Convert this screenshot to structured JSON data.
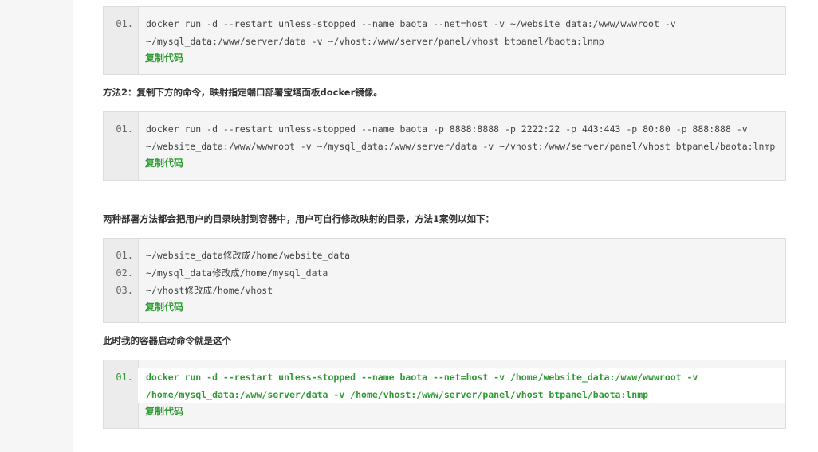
{
  "blocks": [
    {
      "lines": [
        {
          "num": "01.",
          "text": "docker run -d --restart unless-stopped --name baota --net=host -v ~/website_data:/www/wwwroot -v"
        },
        {
          "num": "",
          "text": "~/mysql_data:/www/server/data -v ~/vhost:/www/server/panel/vhost btpanel/baota:lnmp"
        }
      ],
      "copy_label": "复制代码"
    },
    {
      "lines": [
        {
          "num": "01.",
          "text": "docker run -d --restart unless-stopped --name baota -p 8888:8888 -p 2222:22 -p 443:443 -p 80:80 -p 888:888 -v"
        },
        {
          "num": "",
          "text": "~/website_data:/www/wwwroot -v ~/mysql_data:/www/server/data -v ~/vhost:/www/server/panel/vhost btpanel/baota:lnmp"
        }
      ],
      "copy_label": "复制代码"
    },
    {
      "lines": [
        {
          "num": "01.",
          "text": "~/website_data修改成/home/website_data"
        },
        {
          "num": "02.",
          "text": "~/mysql_data修改成/home/mysql_data"
        },
        {
          "num": "03.",
          "text": "~/vhost修改成/home/vhost"
        }
      ],
      "copy_label": "复制代码"
    },
    {
      "lines": [
        {
          "num": "01.",
          "text": "docker run -d --restart unless-stopped --name baota --net=host -v /home/website_data:/www/wwwroot -v"
        },
        {
          "num": "",
          "text": "/home/mysql_data:/www/server/data -v /home/vhost:/www/server/panel/vhost btpanel/baota:lnmp"
        }
      ],
      "copy_label": "复制代码"
    }
  ],
  "paragraphs": {
    "method2": "方法2：复制下方的命令，映射指定端口部署宝塔面板docker镜像。",
    "both_methods": "两种部署方法都会把用户的目录映射到容器中，用户可自行修改映射的目录，方法1案例以如下：",
    "now_command": "此时我的容器启动命令就是这个"
  },
  "colors": {
    "accent_green": "#2e9b33",
    "code_bg": "#f5f5f5",
    "gutter_bg": "#ececec"
  }
}
